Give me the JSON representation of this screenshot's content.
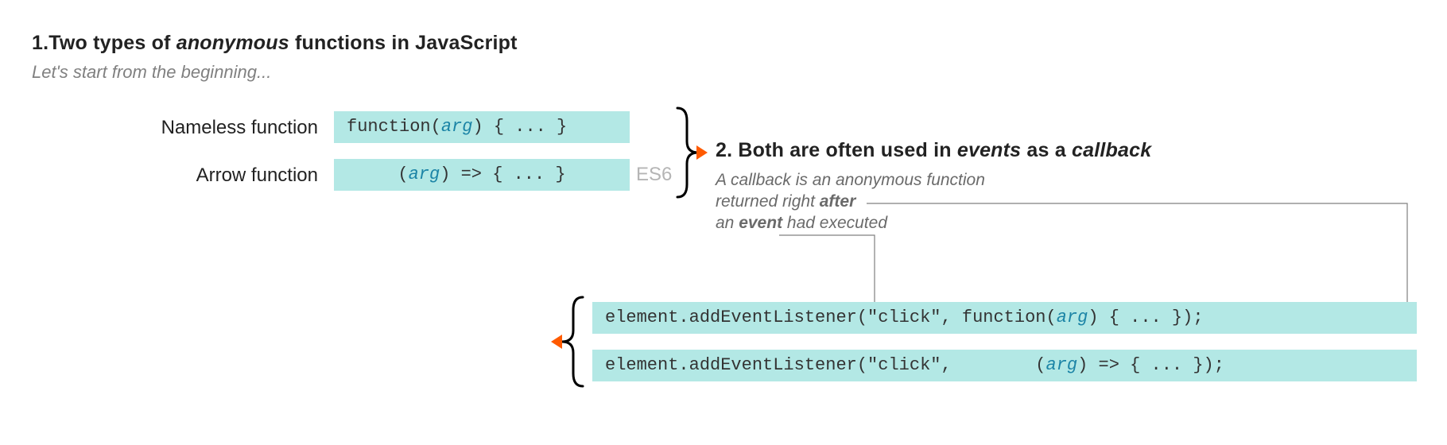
{
  "section1": {
    "heading_prefix": "1.Two types of ",
    "heading_em": "anonymous",
    "heading_suffix": " functions in JavaScript",
    "subtitle": "Let's start from the beginning...",
    "row1_label": "Nameless function",
    "row1_code_pre": "function(",
    "row1_code_arg": "arg",
    "row1_code_post": ") { ... }",
    "row2_label": "Arrow function",
    "row2_code_pre": "(",
    "row2_code_arg": "arg",
    "row2_code_post": ") => { ... }",
    "es6_badge": "ES6"
  },
  "section2": {
    "heading_prefix": "2. Both are often used in ",
    "heading_em1": "events",
    "heading_mid": " as a ",
    "heading_em2": "callback",
    "desc_l1a": "A callback is an anonymous function",
    "desc_l2a": "returned right ",
    "desc_l2b": "after",
    "desc_l3a": "an ",
    "desc_l3b": "event",
    "desc_l3c": " had executed",
    "code1_pre": "element.addEventListener(\"click\", function(",
    "code1_arg": "arg",
    "code1_post": ") { ... });",
    "code2_pre": "element.addEventListener(\"click\",        (",
    "code2_arg": "arg",
    "code2_post": ") => { ... });"
  }
}
